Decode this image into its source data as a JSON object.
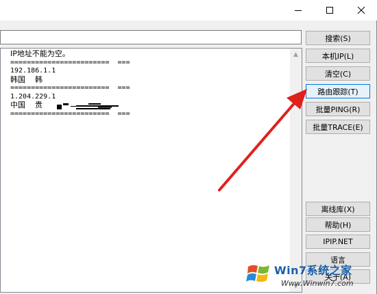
{
  "window": {
    "controls": {
      "minimize": "–",
      "maximize": "☐",
      "close": "✕"
    }
  },
  "input": {
    "value": ""
  },
  "output": {
    "lines": [
      {
        "text": "IP地址不能为空。",
        "cjk": true
      },
      {
        "text": "========================  ===",
        "cjk": false
      },
      {
        "text": "192.186.1.1",
        "cjk": false
      },
      {
        "text": "韩国    韩",
        "cjk": true
      },
      {
        "text": "========================  ===",
        "cjk": false
      },
      {
        "text": "1.204.229.1",
        "cjk": false
      },
      {
        "text": "中国    贵",
        "cjk": true
      },
      {
        "text": "========================  ===",
        "cjk": false
      }
    ]
  },
  "buttons": {
    "search": "搜索(S)",
    "local_ip": "本机IP(L)",
    "clear": "清空(C)",
    "route_trace": "路由跟踪(T)",
    "batch_ping": "批量PING(R)",
    "batch_trace": "批量TRACE(E)",
    "offline_db": "离线库(X)",
    "help": "帮助(H)",
    "ipip": "IPIP.NET",
    "language": "语言",
    "about": "关于(A)"
  },
  "watermark": {
    "brand": "Win7系统之家",
    "url": "Www.Winwin7.com"
  },
  "colors": {
    "accent": "#0078d7",
    "arrow": "#e0201b"
  }
}
